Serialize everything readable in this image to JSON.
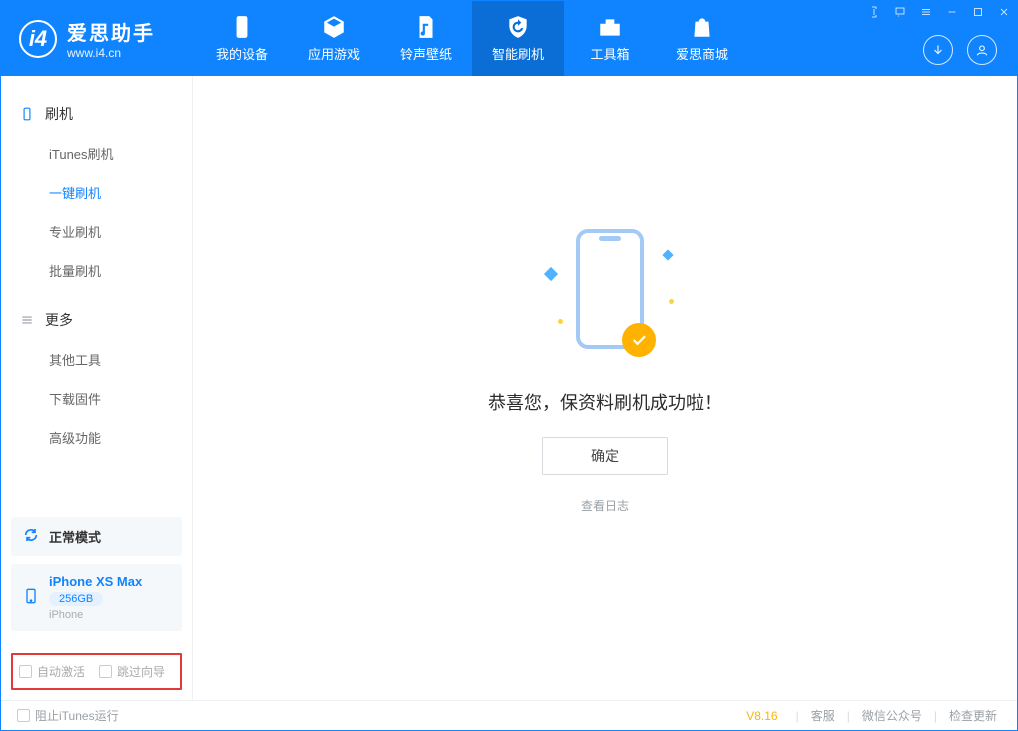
{
  "brand": {
    "name": "爱思助手",
    "site": "www.i4.cn"
  },
  "nav": {
    "items": [
      {
        "label": "我的设备"
      },
      {
        "label": "应用游戏"
      },
      {
        "label": "铃声壁纸"
      },
      {
        "label": "智能刷机"
      },
      {
        "label": "工具箱"
      },
      {
        "label": "爱思商城"
      }
    ],
    "activeIndex": 3
  },
  "sidebar": {
    "group1": {
      "title": "刷机",
      "items": [
        {
          "label": "iTunes刷机"
        },
        {
          "label": "一键刷机"
        },
        {
          "label": "专业刷机"
        },
        {
          "label": "批量刷机"
        }
      ],
      "activeIndex": 1
    },
    "group2": {
      "title": "更多",
      "items": [
        {
          "label": "其他工具"
        },
        {
          "label": "下载固件"
        },
        {
          "label": "高级功能"
        }
      ]
    },
    "mode": {
      "label": "正常模式"
    },
    "device": {
      "name": "iPhone XS Max",
      "capacity": "256GB",
      "kind": "iPhone"
    },
    "options": {
      "autoActivate": "自动激活",
      "skipGuide": "跳过向导"
    }
  },
  "main": {
    "successMsg": "恭喜您，保资料刷机成功啦！",
    "confirm": "确定",
    "viewLog": "查看日志"
  },
  "footer": {
    "blockItunes": "阻止iTunes运行",
    "version": "V8.16",
    "links": {
      "service": "客服",
      "wechat": "微信公众号",
      "update": "检查更新"
    }
  }
}
